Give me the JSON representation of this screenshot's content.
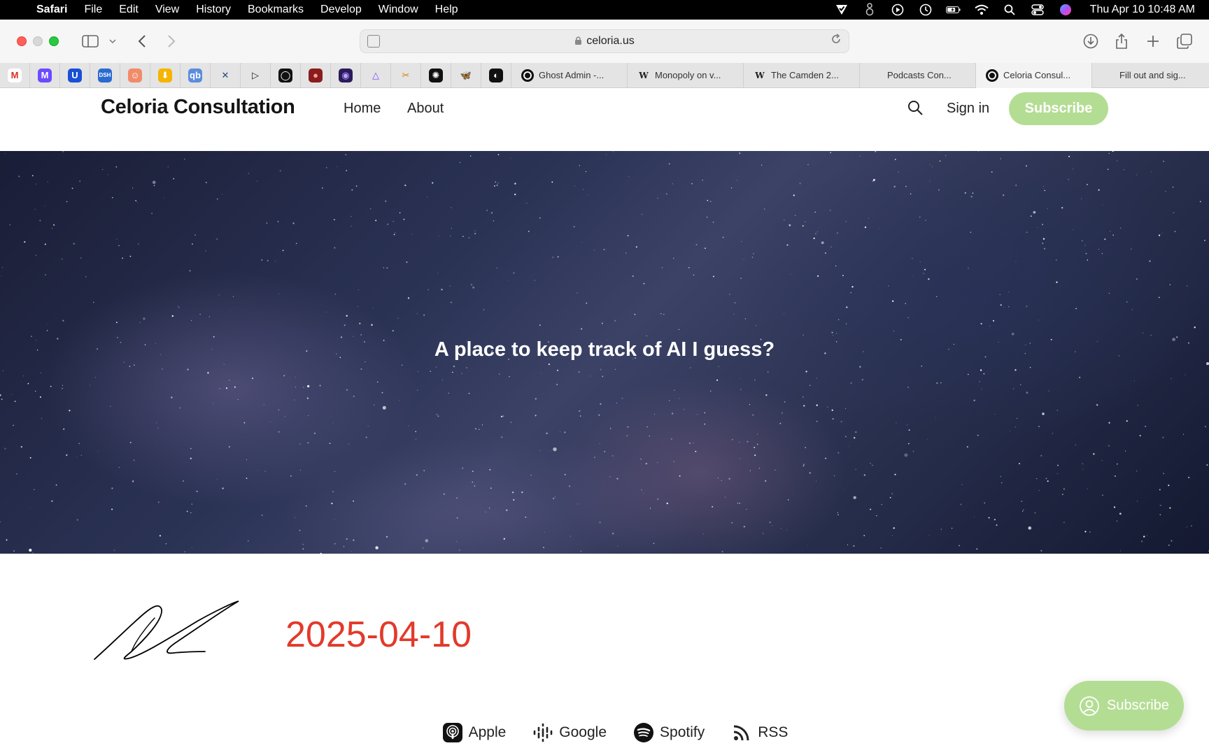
{
  "menubar": {
    "apple_glyph": "",
    "app_name": "Safari",
    "items": [
      "File",
      "Edit",
      "View",
      "History",
      "Bookmarks",
      "Develop",
      "Window",
      "Help"
    ],
    "clock": "Thu Apr 10  10:48 AM"
  },
  "browser": {
    "url": "celoria.us",
    "tabs": [
      {
        "label": "Ghost Admin -...",
        "favicon": "ghost"
      },
      {
        "label": "Monopoly on v...",
        "favicon": "wiki"
      },
      {
        "label": "The Camden 2...",
        "favicon": "wiki"
      },
      {
        "label": "Podcasts Con...",
        "favicon": "apple"
      },
      {
        "label": "Celoria Consul...",
        "favicon": "ghost",
        "active": true
      },
      {
        "label": "Fill out and sig...",
        "favicon": "apple"
      }
    ],
    "pinned_tabs": [
      {
        "name": "gmail-pinned-tab",
        "color": "#ffffff",
        "glyph": "M",
        "fg": "#d93025"
      },
      {
        "name": "proton-mail-pinned-tab",
        "color": "#6d4aff",
        "glyph": "M",
        "fg": "#ffffff"
      },
      {
        "name": "u-pinned-tab",
        "color": "#1a4fd6",
        "glyph": "U",
        "fg": "#ffffff"
      },
      {
        "name": "dsh-pinned-tab",
        "color": "#2a6ad1",
        "glyph": "DSH",
        "fg": "#ffffff"
      },
      {
        "name": "avatar-pinned-tab",
        "color": "#f28b6a",
        "glyph": "☺",
        "fg": "#ffffff"
      },
      {
        "name": "download-pinned-tab",
        "color": "#f4b400",
        "glyph": "⬇",
        "fg": "#ffffff"
      },
      {
        "name": "qb-pinned-tab",
        "color": "#5b8ddb",
        "glyph": "qb",
        "fg": "#ffffff"
      },
      {
        "name": "x-tool-pinned-tab",
        "color": "#e4e4e4",
        "glyph": "✕",
        "fg": "#1f4d7a"
      },
      {
        "name": "play-pinned-tab",
        "color": "#e4e4e4",
        "glyph": "▷",
        "fg": "#222222"
      },
      {
        "name": "circle-pinned-tab",
        "color": "#111111",
        "glyph": "◯",
        "fg": "#ffffff"
      },
      {
        "name": "red-logo-pinned-tab",
        "color": "#8a1c1c",
        "glyph": "●",
        "fg": "#f3a0a0"
      },
      {
        "name": "purple-logo-pinned-tab",
        "color": "#2b1a5c",
        "glyph": "◉",
        "fg": "#b7a0ff"
      },
      {
        "name": "triangle-pinned-tab",
        "color": "#e4e4e4",
        "glyph": "△",
        "fg": "#7a4cff"
      },
      {
        "name": "tools-pinned-tab",
        "color": "#e4e4e4",
        "glyph": "✂",
        "fg": "#e07b00"
      },
      {
        "name": "openai-pinned-tab",
        "color": "#111111",
        "glyph": "✺",
        "fg": "#ffffff"
      },
      {
        "name": "bluesky-pinned-tab",
        "color": "#e4e4e4",
        "glyph": "🦋",
        "fg": "#1185fe"
      },
      {
        "name": "github-pinned-tab",
        "color": "#111111",
        "glyph": "◐",
        "fg": "#ffffff"
      }
    ]
  },
  "site": {
    "brand": "Celoria Consultation",
    "nav": [
      "Home",
      "About"
    ],
    "sign_in": "Sign in",
    "subscribe": "Subscribe",
    "accent_color": "#b4dd94",
    "hero_title": "A place to keep track of AI I guess?",
    "date": "2025-04-10",
    "date_color": "#e23a2b",
    "podcasts": [
      {
        "label": "Apple",
        "icon": "apple-podcasts-icon"
      },
      {
        "label": "Google",
        "icon": "google-podcasts-icon"
      },
      {
        "label": "Spotify",
        "icon": "spotify-icon"
      },
      {
        "label": "RSS",
        "icon": "rss-icon"
      }
    ],
    "portal_subscribe": "Subscribe"
  }
}
